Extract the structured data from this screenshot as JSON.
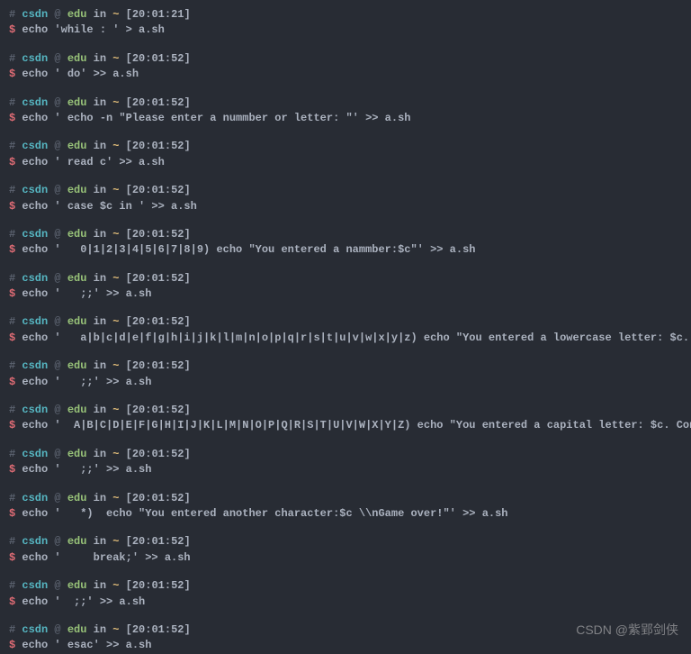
{
  "prompt": {
    "hash": "#",
    "user": "csdn",
    "at": "@",
    "host": "edu",
    "sep1": "in",
    "path": "~",
    "dollar": "$"
  },
  "blocks": [
    {
      "time": "[20:01:21]",
      "cmd": "echo 'while : ' > a.sh"
    },
    {
      "time": "[20:01:52]",
      "cmd": "echo ' do' >> a.sh"
    },
    {
      "time": "[20:01:52]",
      "cmd": "echo ' echo -n \"Please enter a nummber or letter: \"' >> a.sh"
    },
    {
      "time": "[20:01:52]",
      "cmd": "echo ' read c' >> a.sh"
    },
    {
      "time": "[20:01:52]",
      "cmd": "echo ' case $c in ' >> a.sh"
    },
    {
      "time": "[20:01:52]",
      "cmd": "echo '   0|1|2|3|4|5|6|7|8|9) echo \"You entered a nammber:$c\"' >> a.sh"
    },
    {
      "time": "[20:01:52]",
      "cmd": "echo '   ;;' >> a.sh"
    },
    {
      "time": "[20:01:52]",
      "cmd": "echo '   a|b|c|d|e|f|g|h|i|j|k|l|m|n|o|p|q|r|s|t|u|v|w|x|y|z) echo \"You entered a lowercase letter: $c. Continue.\"' >> a.sh"
    },
    {
      "time": "[20:01:52]",
      "cmd": "echo '   ;;' >> a.sh"
    },
    {
      "time": "[20:01:52]",
      "cmd": "echo '  A|B|C|D|E|F|G|H|I|J|K|L|M|N|O|P|Q|R|S|T|U|V|W|X|Y|Z) echo \"You entered a capital letter: $c. Continue.\" ' >> a.sh"
    },
    {
      "time": "[20:01:52]",
      "cmd": "echo '   ;;' >> a.sh"
    },
    {
      "time": "[20:01:52]",
      "cmd": "echo '   *)  echo \"You entered another character:$c \\\\nGame over!\"' >> a.sh"
    },
    {
      "time": "[20:01:52]",
      "cmd": "echo '     break;' >> a.sh"
    },
    {
      "time": "[20:01:52]",
      "cmd": "echo '  ;;' >> a.sh"
    },
    {
      "time": "[20:01:52]",
      "cmd": "echo ' esac' >> a.sh"
    }
  ],
  "watermark": "CSDN @紫郢剑侠"
}
